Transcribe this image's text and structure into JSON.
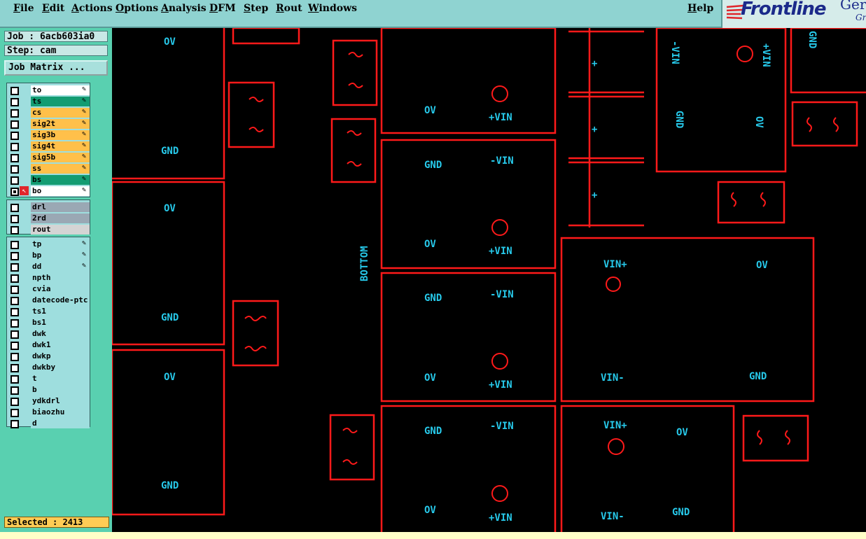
{
  "menu": {
    "items": [
      "File",
      "Edit",
      "Actions",
      "Options",
      "Analysis",
      "DFM",
      "Step",
      "Rout",
      "Windows"
    ],
    "help": "Help"
  },
  "brand": {
    "name": "Frontline",
    "suffix": "Ger",
    "sub": "Gr"
  },
  "job": {
    "label": "Job : 6acb603ia0",
    "step": "Step: cam"
  },
  "job_matrix_button": "Job Matrix ...",
  "layers": {
    "signal": [
      {
        "name": "to",
        "color": "#ffffff",
        "edit": true,
        "checked": false
      },
      {
        "name": "ts",
        "color": "#139c72",
        "edit": true,
        "checked": false
      },
      {
        "name": "cs",
        "color": "#ffc04a",
        "edit": true,
        "checked": false
      },
      {
        "name": "sig2t",
        "color": "#ffc04a",
        "edit": true,
        "checked": false
      },
      {
        "name": "sig3b",
        "color": "#ffc04a",
        "edit": true,
        "checked": false
      },
      {
        "name": "sig4t",
        "color": "#ffc04a",
        "edit": true,
        "checked": false
      },
      {
        "name": "sig5b",
        "color": "#ffc04a",
        "edit": true,
        "checked": false
      },
      {
        "name": "ss",
        "color": "#ffc04a",
        "edit": true,
        "checked": false
      },
      {
        "name": "bs",
        "color": "#139c72",
        "edit": true,
        "checked": false
      },
      {
        "name": "bo",
        "color": "#ffffff",
        "edit": true,
        "checked": true,
        "active": true
      }
    ],
    "drill": [
      {
        "name": "drl",
        "color": "#9aa8b4"
      },
      {
        "name": "2rd",
        "color": "#9aa8b4"
      },
      {
        "name": "rout",
        "color": "#d4d4d4"
      }
    ],
    "misc": [
      {
        "name": "tp",
        "edit": true
      },
      {
        "name": "bp",
        "edit": true
      },
      {
        "name": "dd",
        "edit": true
      },
      {
        "name": "npth"
      },
      {
        "name": "cvia"
      },
      {
        "name": "datecode-ptc"
      },
      {
        "name": "ts1"
      },
      {
        "name": "bs1"
      },
      {
        "name": "dwk"
      },
      {
        "name": "dwk1"
      },
      {
        "name": "dwkp"
      },
      {
        "name": "dwkby"
      },
      {
        "name": "t"
      },
      {
        "name": "b"
      },
      {
        "name": "ydkdrl"
      },
      {
        "name": "biaozhu"
      },
      {
        "name": "d"
      }
    ],
    "misc_color": "#9edede"
  },
  "selected": "Selected : 2413",
  "board_text": {
    "ov": "OV",
    "gnd": "GND",
    "vin_plus": "+VIN",
    "vin_minus": "-VIN",
    "vin_plus_r": "VIN+",
    "vin_minus_r": "VIN-",
    "bottom": "BOTTOM",
    "plus": "+"
  },
  "colors": {
    "outline": "#ff1a1a",
    "text": "#27c9ea",
    "panel": "#59d0b0",
    "menubar": "#8fd3d1"
  },
  "icons": {
    "edit": "pencil-icon",
    "active": "arrow-pointer-icon"
  }
}
